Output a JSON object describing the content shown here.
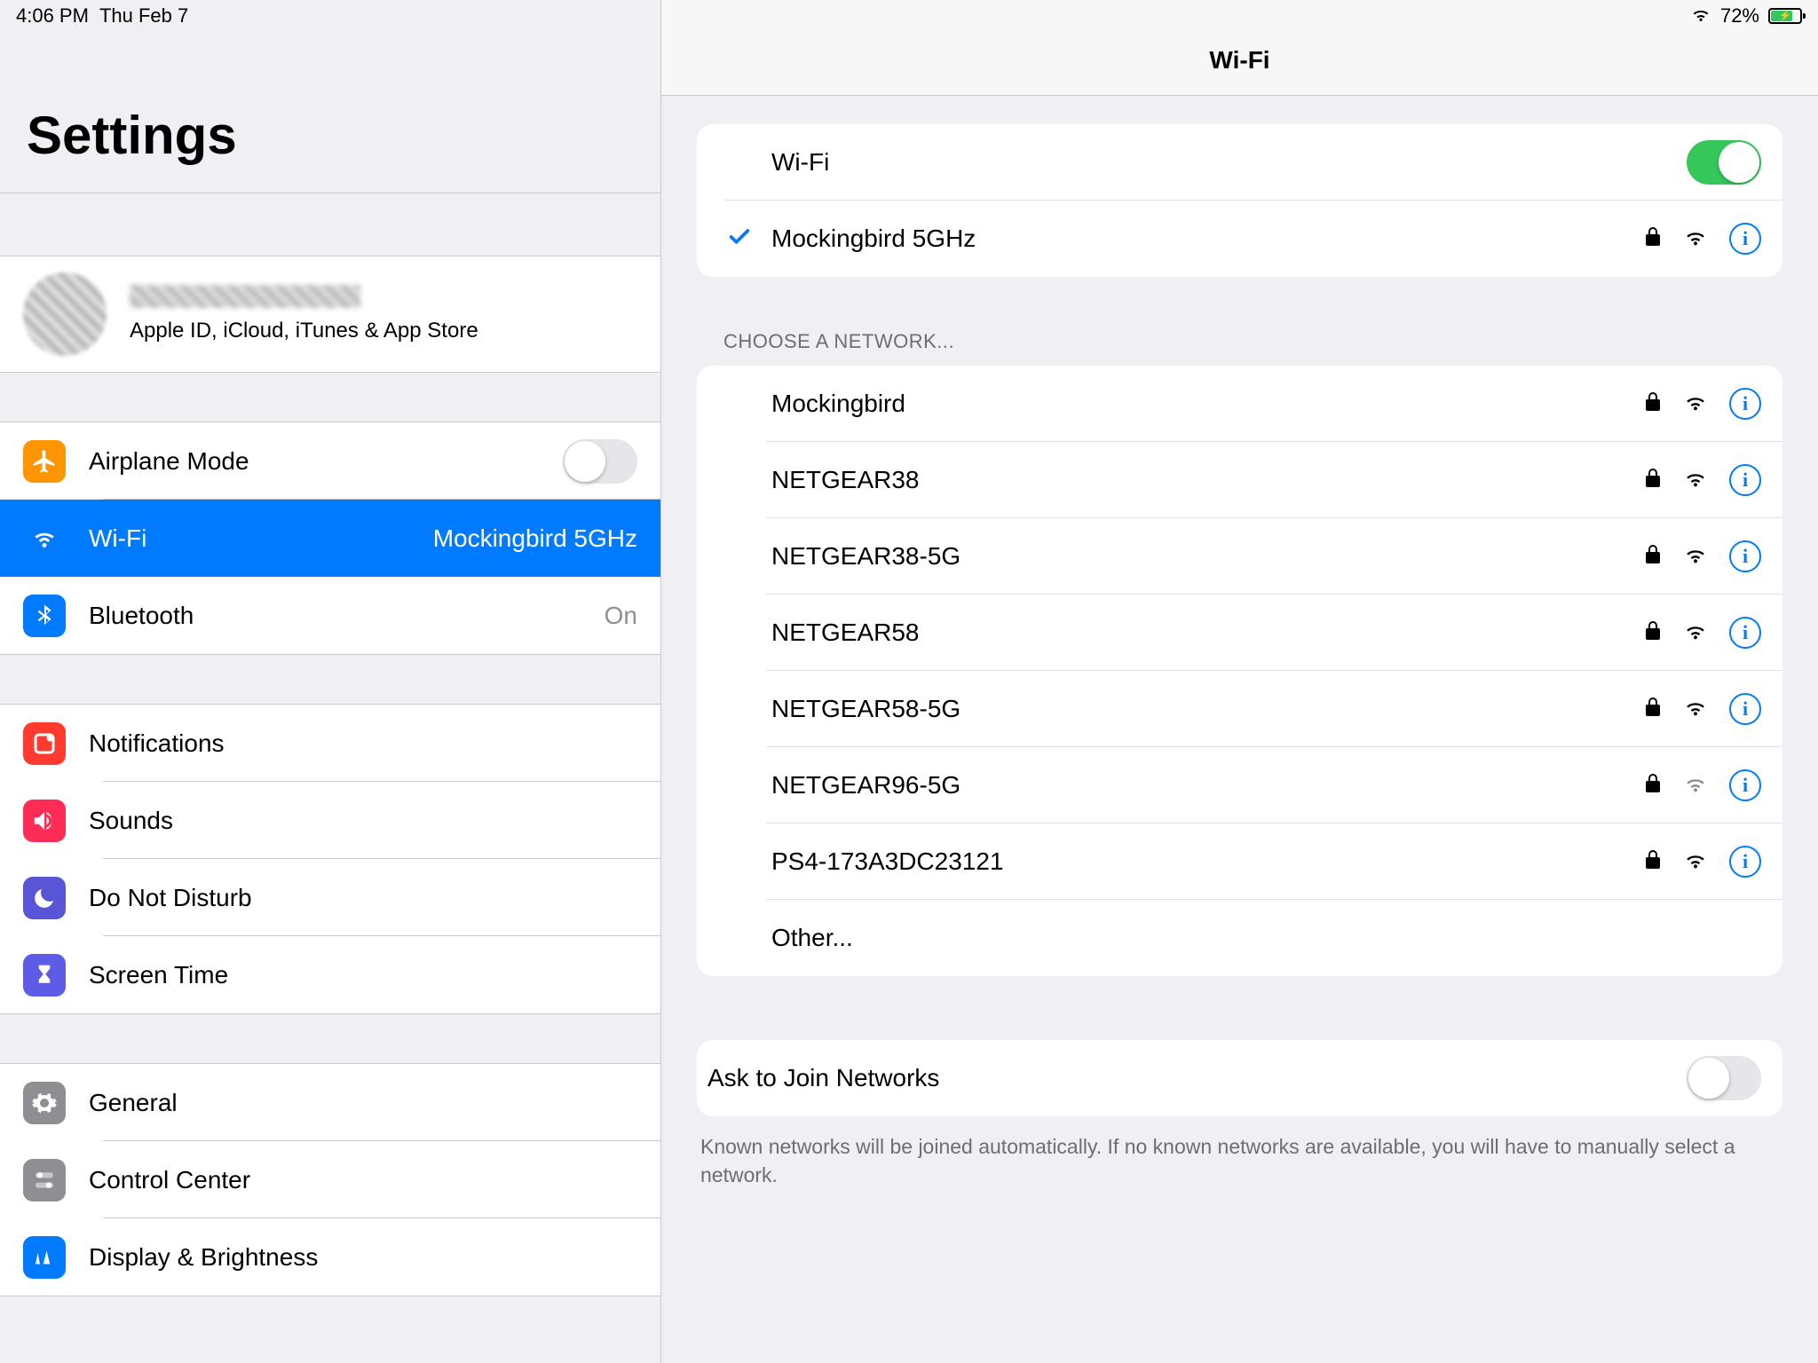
{
  "status": {
    "time": "4:06 PM",
    "date": "Thu Feb 7",
    "battery": "72%"
  },
  "sidebar": {
    "title": "Settings",
    "account_sub": "Apple ID, iCloud, iTunes & App Store",
    "items": {
      "airplane": "Airplane Mode",
      "wifi": "Wi-Fi",
      "wifi_value": "Mockingbird 5GHz",
      "bluetooth": "Bluetooth",
      "bluetooth_value": "On",
      "notifications": "Notifications",
      "sounds": "Sounds",
      "dnd": "Do Not Disturb",
      "screentime": "Screen Time",
      "general": "General",
      "control": "Control Center",
      "display": "Display & Brightness"
    }
  },
  "detail": {
    "title": "Wi-Fi",
    "wifi_label": "Wi-Fi",
    "wifi_on": true,
    "connected": "Mockingbird 5GHz",
    "choose_header": "CHOOSE A NETWORK...",
    "networks": [
      "Mockingbird",
      "NETGEAR38",
      "NETGEAR38-5G",
      "NETGEAR58",
      "NETGEAR58-5G",
      "NETGEAR96-5G",
      "PS4-173A3DC23121"
    ],
    "other": "Other...",
    "ask_label": "Ask to Join Networks",
    "ask_on": false,
    "ask_footer": "Known networks will be joined automatically. If no known networks are available, you will have to manually select a network."
  }
}
